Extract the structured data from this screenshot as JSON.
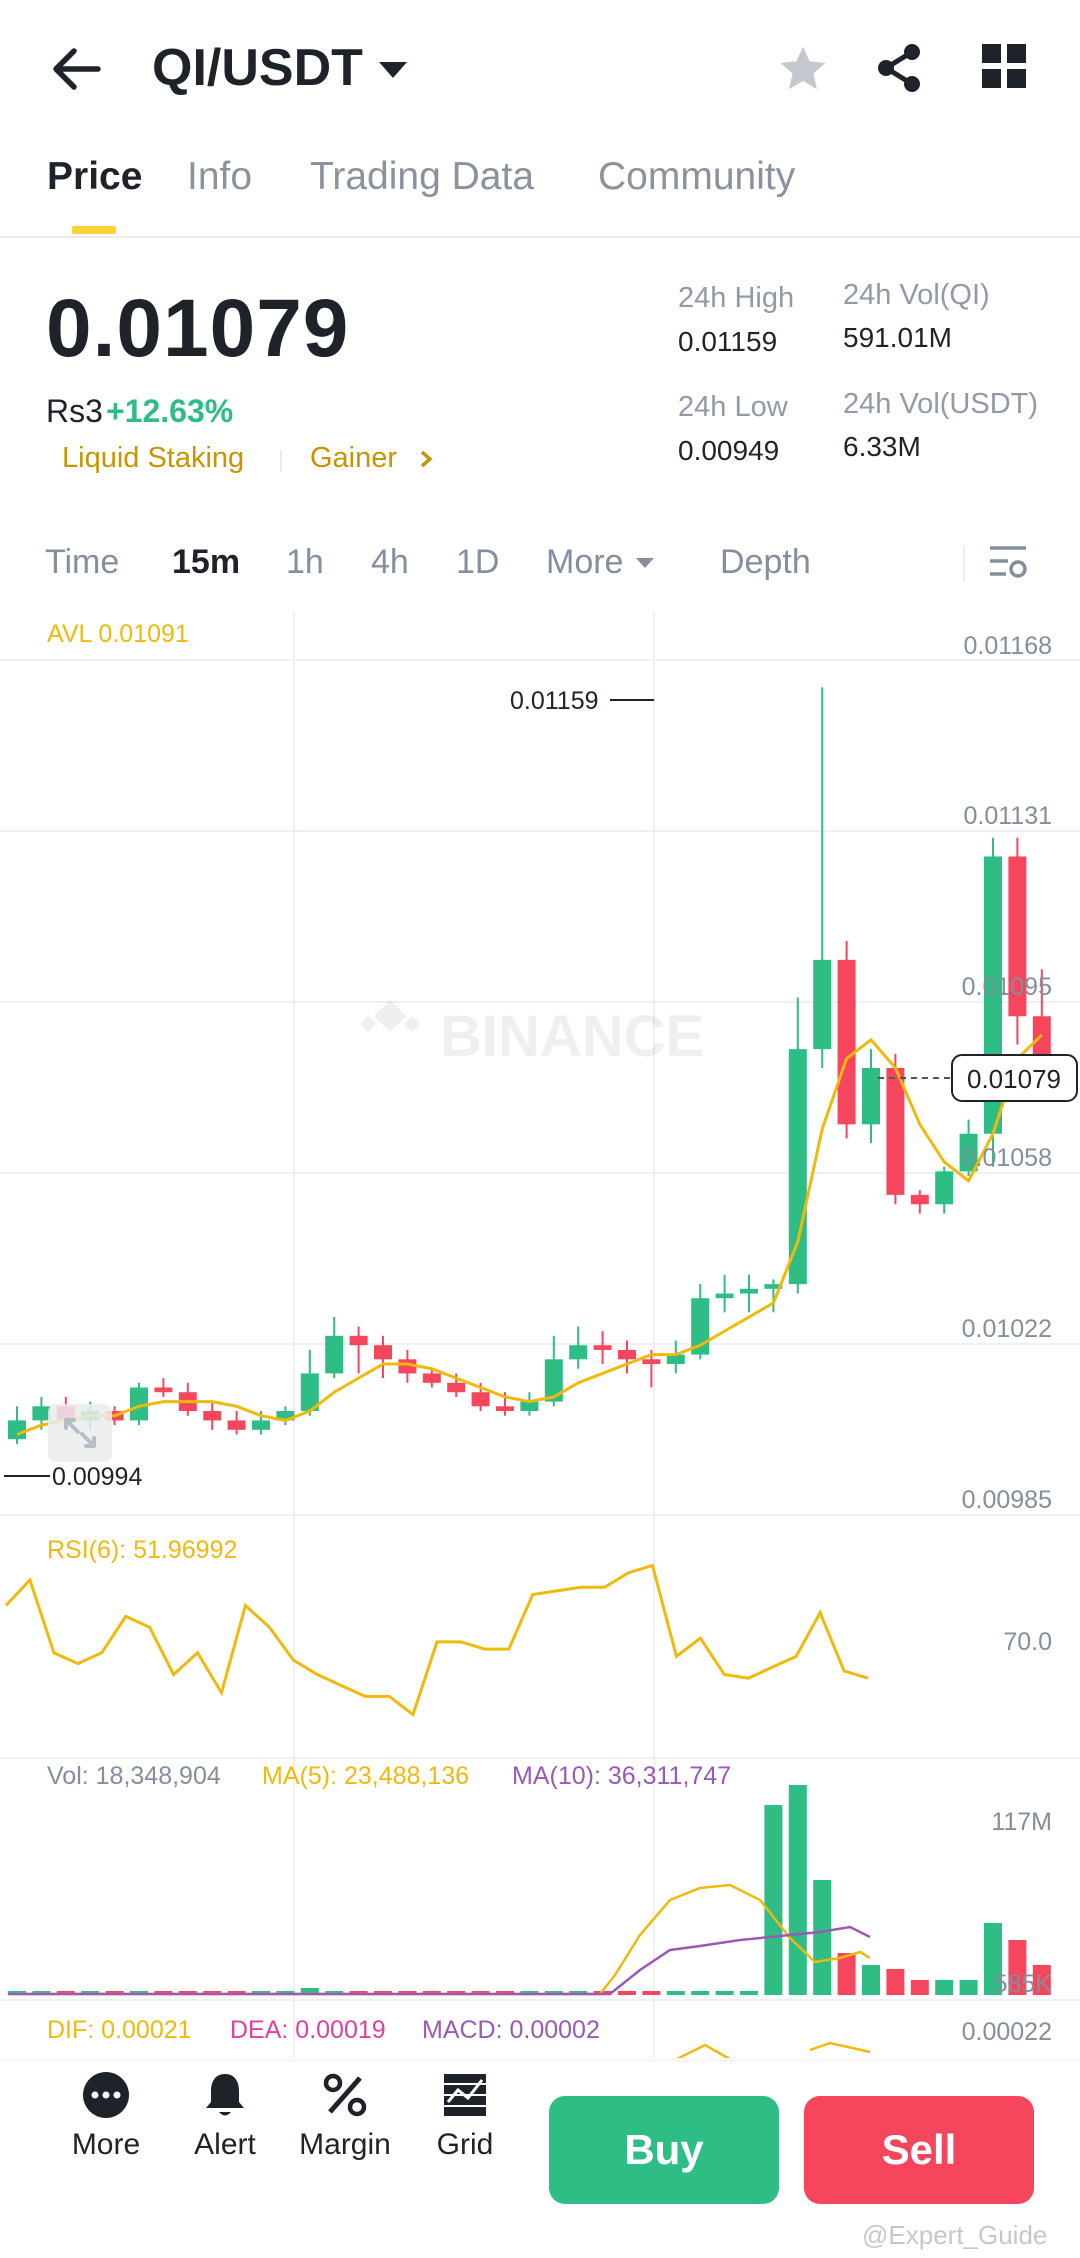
{
  "header": {
    "pair": "QI/USDT",
    "tabs": [
      "Price",
      "Info",
      "Trading Data",
      "Community"
    ]
  },
  "price": {
    "last": "0.01079",
    "fiat": "Rs3",
    "change": "+12.63%",
    "tags": [
      "Liquid Staking",
      "Gainer"
    ]
  },
  "stats": {
    "high_label": "24h High",
    "high": "0.01159",
    "low_label": "24h Low",
    "low": "0.00949",
    "vol_qi_label": "24h Vol(QI)",
    "vol_qi": "591.01M",
    "vol_usdt_label": "24h Vol(USDT)",
    "vol_usdt": "6.33M"
  },
  "timeframes": [
    "Time",
    "15m",
    "1h",
    "4h",
    "1D",
    "More",
    "Depth"
  ],
  "chart": {
    "avl": "AVL 0.01091",
    "y_ticks": [
      "0.01168",
      "0.01131",
      "0.01095",
      "0.01058",
      "0.01022",
      "0.00985"
    ],
    "max_label": "0.01159",
    "min_label": "0.00994",
    "current_label": "0.01079",
    "watermark": "BINANCE"
  },
  "indicators": {
    "rsi": "RSI(6): 51.96992",
    "rsi_level": "70.0",
    "vol": "Vol: 18,348,904",
    "ma5": "MA(5): 23,488,136",
    "ma10": "MA(10): 36,311,747",
    "vol_top": "117M",
    "vol_bottom": "585K",
    "dif": "DIF: 0.00021",
    "dea": "DEA: 0.00019",
    "macd": "MACD: 0.00002",
    "macd_top": "0.00022"
  },
  "colors": {
    "up": "#2ebd85",
    "down": "#f6465d",
    "accent": "#fcd535",
    "ma_yellow": "#f0b90b",
    "ma_purple": "#9b59b6"
  },
  "bottom": {
    "more": "More",
    "alert": "Alert",
    "margin": "Margin",
    "grid": "Grid",
    "buy": "Buy",
    "sell": "Sell",
    "watermark": "@Expert_Guide"
  },
  "chart_data": {
    "type": "candlestick",
    "interval": "15m",
    "ylim": [
      0.00985,
      0.01168
    ],
    "candles": [
      [
        0.00999,
        0.01003,
        0.00998,
        0.01006
      ],
      [
        0.01003,
        0.01006,
        0.01001,
        0.01008
      ],
      [
        0.01006,
        0.01003,
        0.01002,
        0.01008
      ],
      [
        0.01003,
        0.01005,
        0.01001,
        0.01007
      ],
      [
        0.01005,
        0.01003,
        0.01002,
        0.01006
      ],
      [
        0.01003,
        0.0101,
        0.01002,
        0.01011
      ],
      [
        0.0101,
        0.01009,
        0.01008,
        0.01012
      ],
      [
        0.01009,
        0.01005,
        0.01004,
        0.01011
      ],
      [
        0.01005,
        0.01003,
        0.01001,
        0.01007
      ],
      [
        0.01003,
        0.01001,
        0.01,
        0.01005
      ],
      [
        0.01001,
        0.01003,
        0.01,
        0.01005
      ],
      [
        0.01003,
        0.01005,
        0.01002,
        0.01006
      ],
      [
        0.01005,
        0.01013,
        0.01004,
        0.01018
      ],
      [
        0.01013,
        0.01021,
        0.01012,
        0.01025
      ],
      [
        0.01021,
        0.01019,
        0.01013,
        0.01023
      ],
      [
        0.01019,
        0.01016,
        0.01012,
        0.01021
      ],
      [
        0.01016,
        0.01013,
        0.01011,
        0.01018
      ],
      [
        0.01013,
        0.01011,
        0.0101,
        0.01014
      ],
      [
        0.01011,
        0.01009,
        0.01008,
        0.01013
      ],
      [
        0.01009,
        0.01006,
        0.01005,
        0.01011
      ],
      [
        0.01006,
        0.01005,
        0.01004,
        0.01009
      ],
      [
        0.01005,
        0.01007,
        0.01004,
        0.01009
      ],
      [
        0.01007,
        0.01016,
        0.01006,
        0.01021
      ],
      [
        0.01016,
        0.01019,
        0.01014,
        0.01023
      ],
      [
        0.01019,
        0.01018,
        0.01015,
        0.01022
      ],
      [
        0.01018,
        0.01016,
        0.01013,
        0.0102
      ],
      [
        0.01016,
        0.01015,
        0.0101,
        0.01018
      ],
      [
        0.01015,
        0.01017,
        0.01013,
        0.0102
      ],
      [
        0.01017,
        0.01029,
        0.01016,
        0.01032
      ],
      [
        0.01029,
        0.0103,
        0.01026,
        0.01034
      ],
      [
        0.0103,
        0.01031,
        0.01026,
        0.01034
      ],
      [
        0.01031,
        0.01032,
        0.01026,
        0.01033
      ],
      [
        0.01032,
        0.01082,
        0.0103,
        0.01093
      ],
      [
        0.01082,
        0.01101,
        0.01078,
        0.01159
      ],
      [
        0.01101,
        0.01066,
        0.01063,
        0.01105
      ],
      [
        0.01066,
        0.01078,
        0.01062,
        0.01082
      ],
      [
        0.01078,
        0.01051,
        0.01049,
        0.01081
      ],
      [
        0.01051,
        0.01049,
        0.01047,
        0.01052
      ],
      [
        0.01049,
        0.01056,
        0.01047,
        0.01057
      ],
      [
        0.01056,
        0.01064,
        0.01055,
        0.01067
      ],
      [
        0.01064,
        0.01123,
        0.01057,
        0.01127
      ],
      [
        0.01123,
        0.01089,
        0.01083,
        0.01127
      ],
      [
        0.01089,
        0.01079,
        0.01077,
        0.01099
      ]
    ],
    "ma": [
      0.01,
      0.01002,
      0.01003,
      0.01004,
      0.01004,
      0.01006,
      0.01007,
      0.01007,
      0.01007,
      0.01006,
      0.01004,
      0.01003,
      0.01005,
      0.01009,
      0.01012,
      0.01015,
      0.01015,
      0.01014,
      0.01012,
      0.0101,
      0.01008,
      0.01007,
      0.01008,
      0.01011,
      0.01013,
      0.01015,
      0.01017,
      0.01017,
      0.01019,
      0.01022,
      0.01025,
      0.01028,
      0.01041,
      0.01065,
      0.0108,
      0.01084,
      0.01078,
      0.01066,
      0.01058,
      0.01054,
      0.01064,
      0.0108,
      0.01085
    ],
    "rsi": [
      62,
      69,
      49,
      46,
      49,
      59,
      56,
      43,
      49,
      38,
      62,
      56,
      47,
      43,
      40,
      37,
      37,
      32,
      52,
      52,
      50,
      50,
      65,
      66,
      67,
      67,
      71,
      73,
      48,
      53,
      43,
      42,
      45,
      48,
      60,
      44,
      42
    ],
    "volume_ticks": [
      "117M",
      "585K"
    ]
  }
}
